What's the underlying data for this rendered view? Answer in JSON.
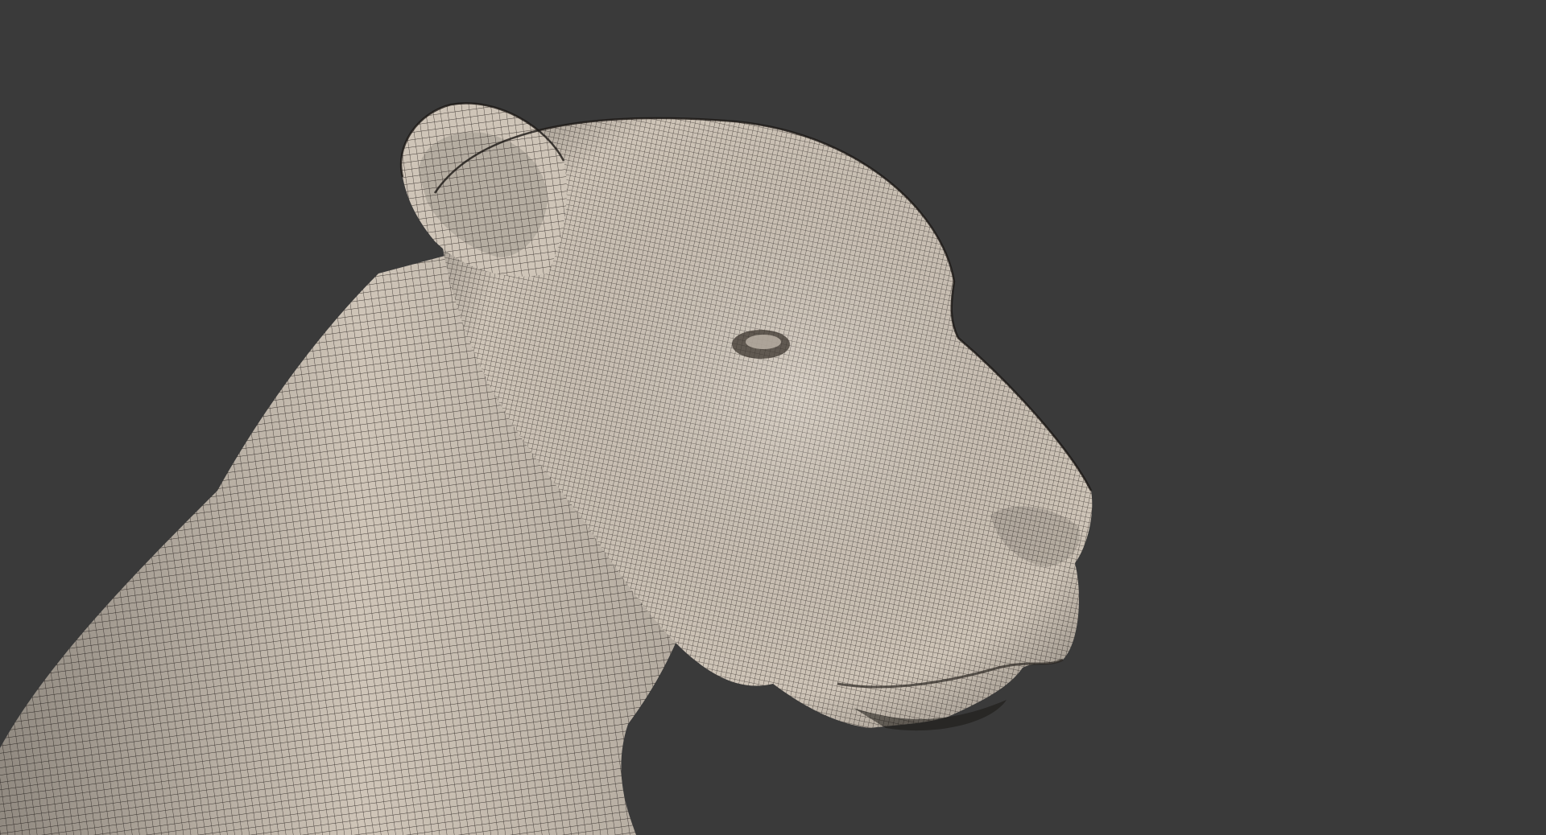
{
  "viewport": {
    "background_color": "#3a3a3a"
  },
  "model": {
    "subject": "lioness-head-wireframe",
    "surface_color": "#cfc5b8",
    "wire_color": "#2b2622",
    "shadow_color": "#8f877c"
  }
}
